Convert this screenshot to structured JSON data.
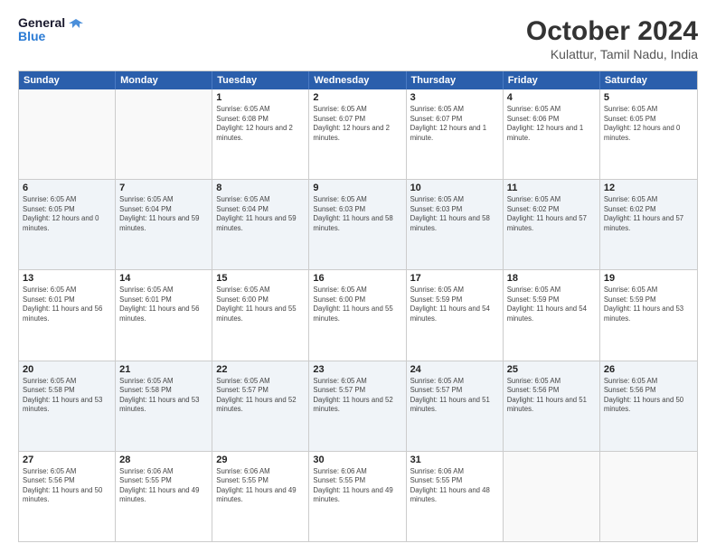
{
  "logo": {
    "line1": "General",
    "line2": "Blue"
  },
  "title": "October 2024",
  "location": "Kulattur, Tamil Nadu, India",
  "days_header": [
    "Sunday",
    "Monday",
    "Tuesday",
    "Wednesday",
    "Thursday",
    "Friday",
    "Saturday"
  ],
  "weeks": [
    [
      {
        "day": "",
        "sunrise": "",
        "sunset": "",
        "daylight": "",
        "empty": true
      },
      {
        "day": "",
        "sunrise": "",
        "sunset": "",
        "daylight": "",
        "empty": true
      },
      {
        "day": "1",
        "sunrise": "Sunrise: 6:05 AM",
        "sunset": "Sunset: 6:08 PM",
        "daylight": "Daylight: 12 hours and 2 minutes."
      },
      {
        "day": "2",
        "sunrise": "Sunrise: 6:05 AM",
        "sunset": "Sunset: 6:07 PM",
        "daylight": "Daylight: 12 hours and 2 minutes."
      },
      {
        "day": "3",
        "sunrise": "Sunrise: 6:05 AM",
        "sunset": "Sunset: 6:07 PM",
        "daylight": "Daylight: 12 hours and 1 minute."
      },
      {
        "day": "4",
        "sunrise": "Sunrise: 6:05 AM",
        "sunset": "Sunset: 6:06 PM",
        "daylight": "Daylight: 12 hours and 1 minute."
      },
      {
        "day": "5",
        "sunrise": "Sunrise: 6:05 AM",
        "sunset": "Sunset: 6:05 PM",
        "daylight": "Daylight: 12 hours and 0 minutes."
      }
    ],
    [
      {
        "day": "6",
        "sunrise": "Sunrise: 6:05 AM",
        "sunset": "Sunset: 6:05 PM",
        "daylight": "Daylight: 12 hours and 0 minutes."
      },
      {
        "day": "7",
        "sunrise": "Sunrise: 6:05 AM",
        "sunset": "Sunset: 6:04 PM",
        "daylight": "Daylight: 11 hours and 59 minutes."
      },
      {
        "day": "8",
        "sunrise": "Sunrise: 6:05 AM",
        "sunset": "Sunset: 6:04 PM",
        "daylight": "Daylight: 11 hours and 59 minutes."
      },
      {
        "day": "9",
        "sunrise": "Sunrise: 6:05 AM",
        "sunset": "Sunset: 6:03 PM",
        "daylight": "Daylight: 11 hours and 58 minutes."
      },
      {
        "day": "10",
        "sunrise": "Sunrise: 6:05 AM",
        "sunset": "Sunset: 6:03 PM",
        "daylight": "Daylight: 11 hours and 58 minutes."
      },
      {
        "day": "11",
        "sunrise": "Sunrise: 6:05 AM",
        "sunset": "Sunset: 6:02 PM",
        "daylight": "Daylight: 11 hours and 57 minutes."
      },
      {
        "day": "12",
        "sunrise": "Sunrise: 6:05 AM",
        "sunset": "Sunset: 6:02 PM",
        "daylight": "Daylight: 11 hours and 57 minutes."
      }
    ],
    [
      {
        "day": "13",
        "sunrise": "Sunrise: 6:05 AM",
        "sunset": "Sunset: 6:01 PM",
        "daylight": "Daylight: 11 hours and 56 minutes."
      },
      {
        "day": "14",
        "sunrise": "Sunrise: 6:05 AM",
        "sunset": "Sunset: 6:01 PM",
        "daylight": "Daylight: 11 hours and 56 minutes."
      },
      {
        "day": "15",
        "sunrise": "Sunrise: 6:05 AM",
        "sunset": "Sunset: 6:00 PM",
        "daylight": "Daylight: 11 hours and 55 minutes."
      },
      {
        "day": "16",
        "sunrise": "Sunrise: 6:05 AM",
        "sunset": "Sunset: 6:00 PM",
        "daylight": "Daylight: 11 hours and 55 minutes."
      },
      {
        "day": "17",
        "sunrise": "Sunrise: 6:05 AM",
        "sunset": "Sunset: 5:59 PM",
        "daylight": "Daylight: 11 hours and 54 minutes."
      },
      {
        "day": "18",
        "sunrise": "Sunrise: 6:05 AM",
        "sunset": "Sunset: 5:59 PM",
        "daylight": "Daylight: 11 hours and 54 minutes."
      },
      {
        "day": "19",
        "sunrise": "Sunrise: 6:05 AM",
        "sunset": "Sunset: 5:59 PM",
        "daylight": "Daylight: 11 hours and 53 minutes."
      }
    ],
    [
      {
        "day": "20",
        "sunrise": "Sunrise: 6:05 AM",
        "sunset": "Sunset: 5:58 PM",
        "daylight": "Daylight: 11 hours and 53 minutes."
      },
      {
        "day": "21",
        "sunrise": "Sunrise: 6:05 AM",
        "sunset": "Sunset: 5:58 PM",
        "daylight": "Daylight: 11 hours and 53 minutes."
      },
      {
        "day": "22",
        "sunrise": "Sunrise: 6:05 AM",
        "sunset": "Sunset: 5:57 PM",
        "daylight": "Daylight: 11 hours and 52 minutes."
      },
      {
        "day": "23",
        "sunrise": "Sunrise: 6:05 AM",
        "sunset": "Sunset: 5:57 PM",
        "daylight": "Daylight: 11 hours and 52 minutes."
      },
      {
        "day": "24",
        "sunrise": "Sunrise: 6:05 AM",
        "sunset": "Sunset: 5:57 PM",
        "daylight": "Daylight: 11 hours and 51 minutes."
      },
      {
        "day": "25",
        "sunrise": "Sunrise: 6:05 AM",
        "sunset": "Sunset: 5:56 PM",
        "daylight": "Daylight: 11 hours and 51 minutes."
      },
      {
        "day": "26",
        "sunrise": "Sunrise: 6:05 AM",
        "sunset": "Sunset: 5:56 PM",
        "daylight": "Daylight: 11 hours and 50 minutes."
      }
    ],
    [
      {
        "day": "27",
        "sunrise": "Sunrise: 6:05 AM",
        "sunset": "Sunset: 5:56 PM",
        "daylight": "Daylight: 11 hours and 50 minutes."
      },
      {
        "day": "28",
        "sunrise": "Sunrise: 6:06 AM",
        "sunset": "Sunset: 5:55 PM",
        "daylight": "Daylight: 11 hours and 49 minutes."
      },
      {
        "day": "29",
        "sunrise": "Sunrise: 6:06 AM",
        "sunset": "Sunset: 5:55 PM",
        "daylight": "Daylight: 11 hours and 49 minutes."
      },
      {
        "day": "30",
        "sunrise": "Sunrise: 6:06 AM",
        "sunset": "Sunset: 5:55 PM",
        "daylight": "Daylight: 11 hours and 49 minutes."
      },
      {
        "day": "31",
        "sunrise": "Sunrise: 6:06 AM",
        "sunset": "Sunset: 5:55 PM",
        "daylight": "Daylight: 11 hours and 48 minutes."
      },
      {
        "day": "",
        "sunrise": "",
        "sunset": "",
        "daylight": "",
        "empty": true
      },
      {
        "day": "",
        "sunrise": "",
        "sunset": "",
        "daylight": "",
        "empty": true
      }
    ]
  ]
}
